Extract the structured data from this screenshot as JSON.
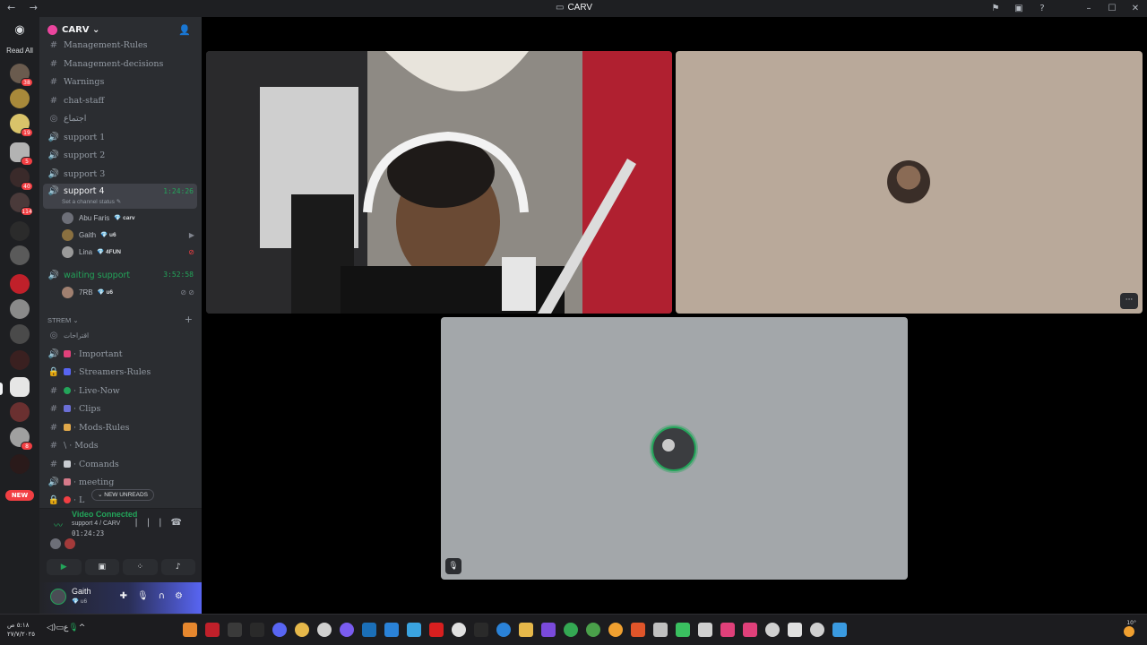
{
  "window": {
    "title": "CARV",
    "nav": "← →"
  },
  "rail": {
    "read_all": "Read All",
    "new_label": "NEW"
  },
  "server": {
    "name": "CARV ⌄"
  },
  "channels": [
    {
      "icon": "#",
      "label": "Management-Rules"
    },
    {
      "icon": "#",
      "label": "Management-decisions"
    },
    {
      "icon": "#",
      "label": "Warnings"
    },
    {
      "icon": "#",
      "label": "chat-staff"
    },
    {
      "icon": "◎",
      "label": "اجتماع"
    },
    {
      "icon": "🔊",
      "label": "support 1"
    },
    {
      "icon": "🔊",
      "label": "support 2"
    },
    {
      "icon": "🔊",
      "label": "support 3"
    }
  ],
  "active_channel": {
    "label": "support 4",
    "time": "1:24:26",
    "status": "Set a channel status ✎"
  },
  "members": [
    {
      "name": "Abu Faris",
      "tag": "💎 carv"
    },
    {
      "name": "Gaith",
      "tag": "💎 u6"
    },
    {
      "name": "Lina",
      "tag": "💎 4FUN"
    }
  ],
  "waiting_channel": {
    "label": "waiting support",
    "time": "3:52:58"
  },
  "waiting_member": {
    "name": "7RB",
    "tag": "💎 u6"
  },
  "category": {
    "label": "STREM ⌄"
  },
  "stream_channels": [
    {
      "icon": "◎",
      "label": "اقتراحات"
    },
    {
      "icon": "🔊",
      "label": "· Important"
    },
    {
      "icon": "🔒",
      "label": "· Streamers-Rules"
    },
    {
      "icon": "#",
      "label": "· Live-Now"
    },
    {
      "icon": "#",
      "label": "· Clips"
    },
    {
      "icon": "#",
      "label": "· Mods-Rules"
    },
    {
      "icon": "#",
      "label": "\\ · Mods"
    },
    {
      "icon": "#",
      "label": "· Comands"
    },
    {
      "icon": "🔊",
      "label": "· meeting"
    },
    {
      "icon": "🔒",
      "label": "· L"
    }
  ],
  "new_unreads": "⌄ NEW UNREADS",
  "voice": {
    "connected": "Video Connected",
    "location": "support 4 / CARV",
    "elapsed": "01:24:23"
  },
  "user": {
    "name": "Gaith",
    "status": "💎 u6"
  },
  "taskbar": {
    "time": "٥:١٨ ص",
    "date": "٢٧/٧/٢٠٢٥",
    "lang": "ع",
    "weather": "10°"
  },
  "colors": {
    "accent_green": "#23a55a",
    "brand": "#5865f2",
    "danger": "#f23f43"
  }
}
